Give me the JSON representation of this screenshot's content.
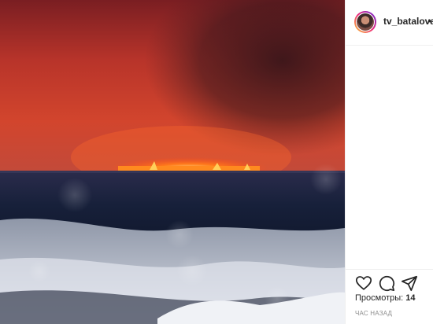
{
  "post": {
    "username": "tv_batalova",
    "follow_separator": "•",
    "views_label": "Просмотры:",
    "views_count": "14",
    "timestamp": "ЧАС НАЗАД"
  },
  "icons": [
    "heart-icon",
    "comment-icon",
    "share-icon"
  ],
  "colors": {
    "sky": "#c63c2a",
    "fire": "#ff7a1a",
    "water": "#1a2440",
    "snow": "#c8ced9",
    "text": "#262626",
    "muted": "#8e8e8e"
  }
}
